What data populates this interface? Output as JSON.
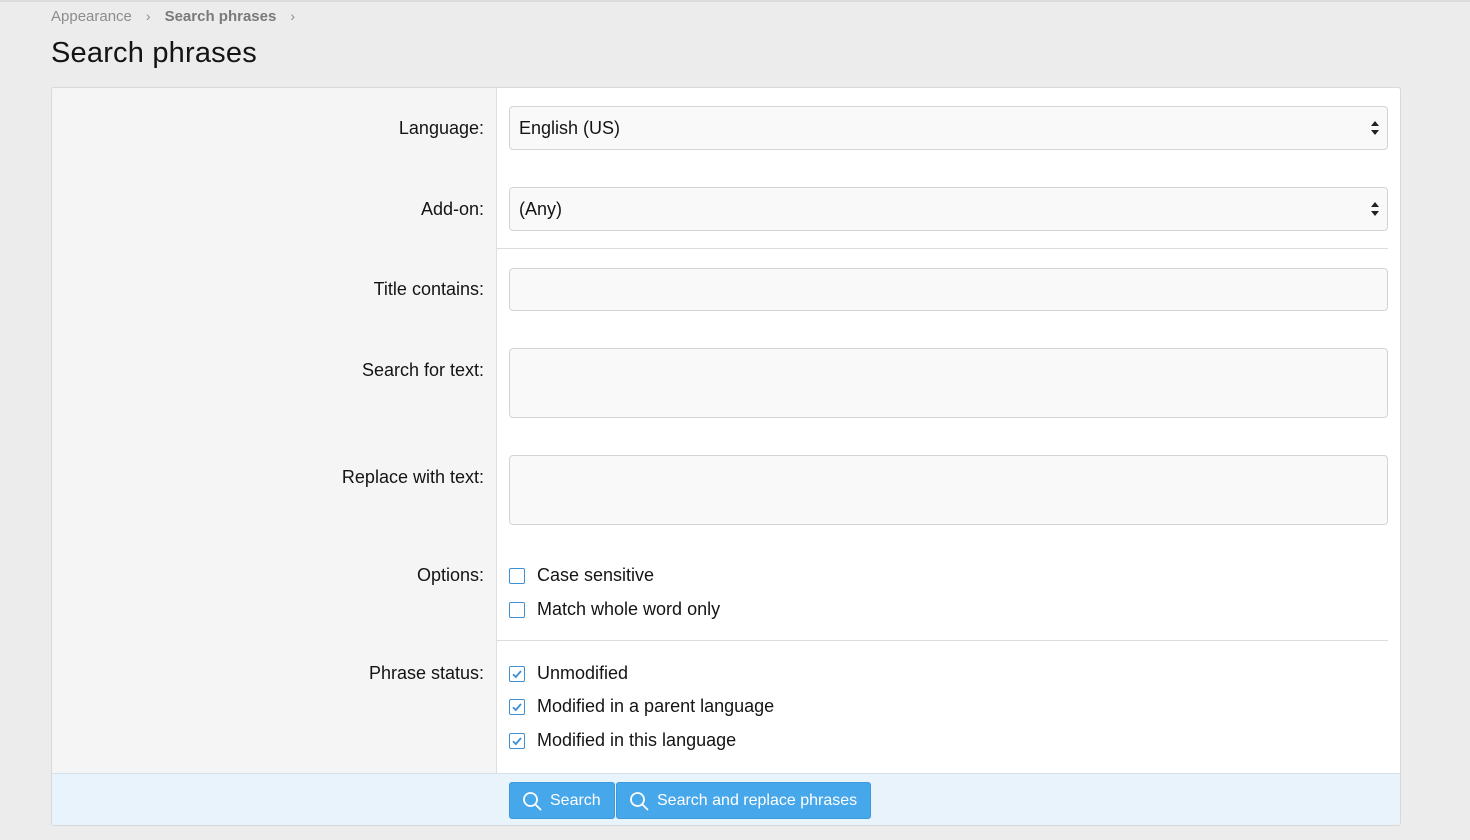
{
  "breadcrumb": {
    "items": [
      "Appearance",
      "Search phrases"
    ],
    "separator": "›"
  },
  "page": {
    "title": "Search phrases"
  },
  "form": {
    "language": {
      "label": "Language:",
      "value": "English (US)"
    },
    "addon": {
      "label": "Add-on:",
      "value": "(Any)"
    },
    "title_contains": {
      "label": "Title contains:",
      "value": ""
    },
    "search_text": {
      "label": "Search for text:",
      "value": ""
    },
    "replace_text": {
      "label": "Replace with text:",
      "value": ""
    },
    "options": {
      "label": "Options:",
      "items": [
        {
          "label": "Case sensitive",
          "checked": false
        },
        {
          "label": "Match whole word only",
          "checked": false
        }
      ]
    },
    "phrase_status": {
      "label": "Phrase status:",
      "items": [
        {
          "label": "Unmodified",
          "checked": true
        },
        {
          "label": "Modified in a parent language",
          "checked": true
        },
        {
          "label": "Modified in this language",
          "checked": true
        }
      ]
    }
  },
  "buttons": {
    "search": {
      "label": "Search",
      "icon": "search-icon"
    },
    "search_replace": {
      "label": "Search and replace phrases",
      "icon": "search-icon"
    }
  },
  "colors": {
    "accent": "#47a7eb",
    "checkbox_border": "#3f8fd5",
    "footer_bg": "#e9f3fb"
  }
}
